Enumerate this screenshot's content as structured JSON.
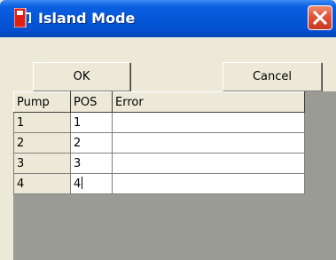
{
  "window": {
    "title": "Island Mode",
    "close_icon": "close-icon",
    "app_icon": "pump-app-icon"
  },
  "buttons": {
    "ok_label": "OK",
    "cancel_label": "Cancel"
  },
  "grid": {
    "columns": [
      "Pump",
      "POS",
      "Error"
    ],
    "rows": [
      {
        "pump": "1",
        "pos": "1",
        "error": ""
      },
      {
        "pump": "2",
        "pos": "2",
        "error": ""
      },
      {
        "pump": "3",
        "pos": "3",
        "error": ""
      },
      {
        "pump": "4",
        "pos": "4",
        "error": ""
      }
    ]
  },
  "colors": {
    "titlebar": "#0657d8",
    "close_button": "#e0533a",
    "window_background": "#ece9d8",
    "grid_background": "#9b9b95"
  }
}
